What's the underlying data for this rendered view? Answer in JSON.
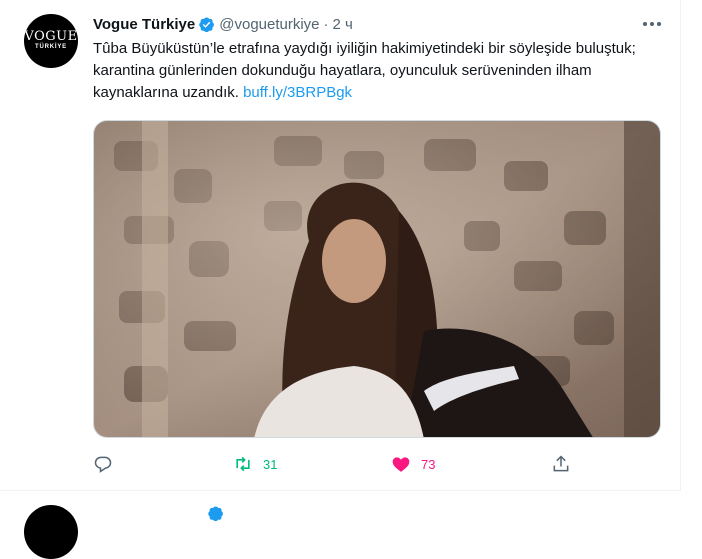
{
  "tweet": {
    "avatar": {
      "line1": "VOGUE",
      "line2": "TÜRKİYE"
    },
    "display_name": "Vogue Türkiye",
    "handle": "@vogueturkiye",
    "separator": "·",
    "time": "2 ч",
    "text_main": "Tûba Büyüküstün’le etrafına yaydığı iyiliğin hakimiyetindeki bir söyleşide buluştuk; karantina günlerinden dokunduğu hayatlara, oyunculuk serüveninden ilham kaynaklarına uzandık. ",
    "text_link": "buff.ly/3BRPBgk",
    "actions": {
      "reply_count": "",
      "retweet_count": "31",
      "like_count": "73"
    }
  },
  "colors": {
    "link": "#1d9bf0",
    "retweet_active": "#00ba7c",
    "like_active": "#f91880",
    "muted": "#536471",
    "verified": "#1d9bf0"
  },
  "icons": [
    "verified-badge-icon",
    "more-icon",
    "reply-icon",
    "retweet-icon",
    "like-icon",
    "share-icon"
  ]
}
